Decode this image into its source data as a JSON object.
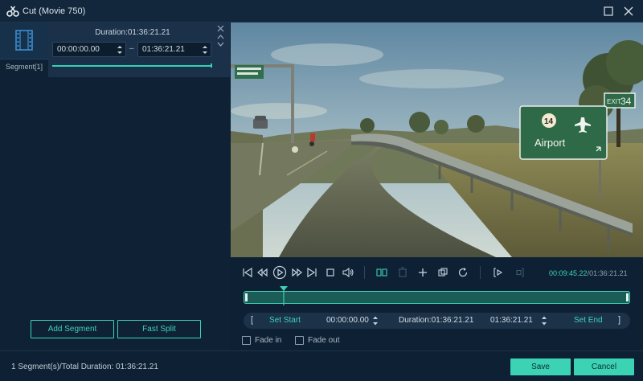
{
  "window": {
    "title": "Cut (Movie 750)",
    "icons": {
      "app": "scissors-icon",
      "restore": "restore-icon",
      "close": "close-icon"
    }
  },
  "segments": {
    "thumb_icon": "film-strip-icon",
    "label": "Segment[1]",
    "duration": "Duration:01:36:21.21",
    "start": "00:00:00.00",
    "dash": "–",
    "end": "01:36:21.21",
    "progress": 1.0
  },
  "left_buttons": {
    "add_segment": "Add Segment",
    "fast_split": "Fast Split"
  },
  "preview": {
    "sign_exit_label": "EXIT",
    "sign_exit_number": "34",
    "sign_route": "14",
    "sign_destination": "Airport"
  },
  "player": {
    "controls": [
      "skip-to-start-icon",
      "step-back-icon",
      "play-icon",
      "step-forward-icon",
      "skip-to-end-icon",
      "stop-icon",
      "volume-icon",
      "split-icon",
      "delete-icon",
      "add-icon",
      "copy-icon",
      "reset-icon",
      "mark-in-icon",
      "mark-out-icon"
    ],
    "current_time": "00:09:45.22",
    "separator": "/",
    "total_time": "01:36:21.21",
    "playhead_fraction": 0.104
  },
  "trim": {
    "left_bracket": "[",
    "set_start": "Set Start",
    "start_value": "00:00:00.00",
    "duration": "Duration:01:36:21.21",
    "end_value": "01:36:21.21",
    "set_end": "Set End",
    "right_bracket": "]"
  },
  "fade": {
    "fade_in": "Fade in",
    "fade_in_checked": false,
    "fade_out": "Fade out",
    "fade_out_checked": false
  },
  "footer": {
    "status": "1 Segment(s)/Total Duration: 01:36:21.21",
    "save": "Save",
    "cancel": "Cancel"
  },
  "colors": {
    "accent": "#3cd2b4",
    "background": "#0e2134",
    "panel": "#1a3149"
  }
}
